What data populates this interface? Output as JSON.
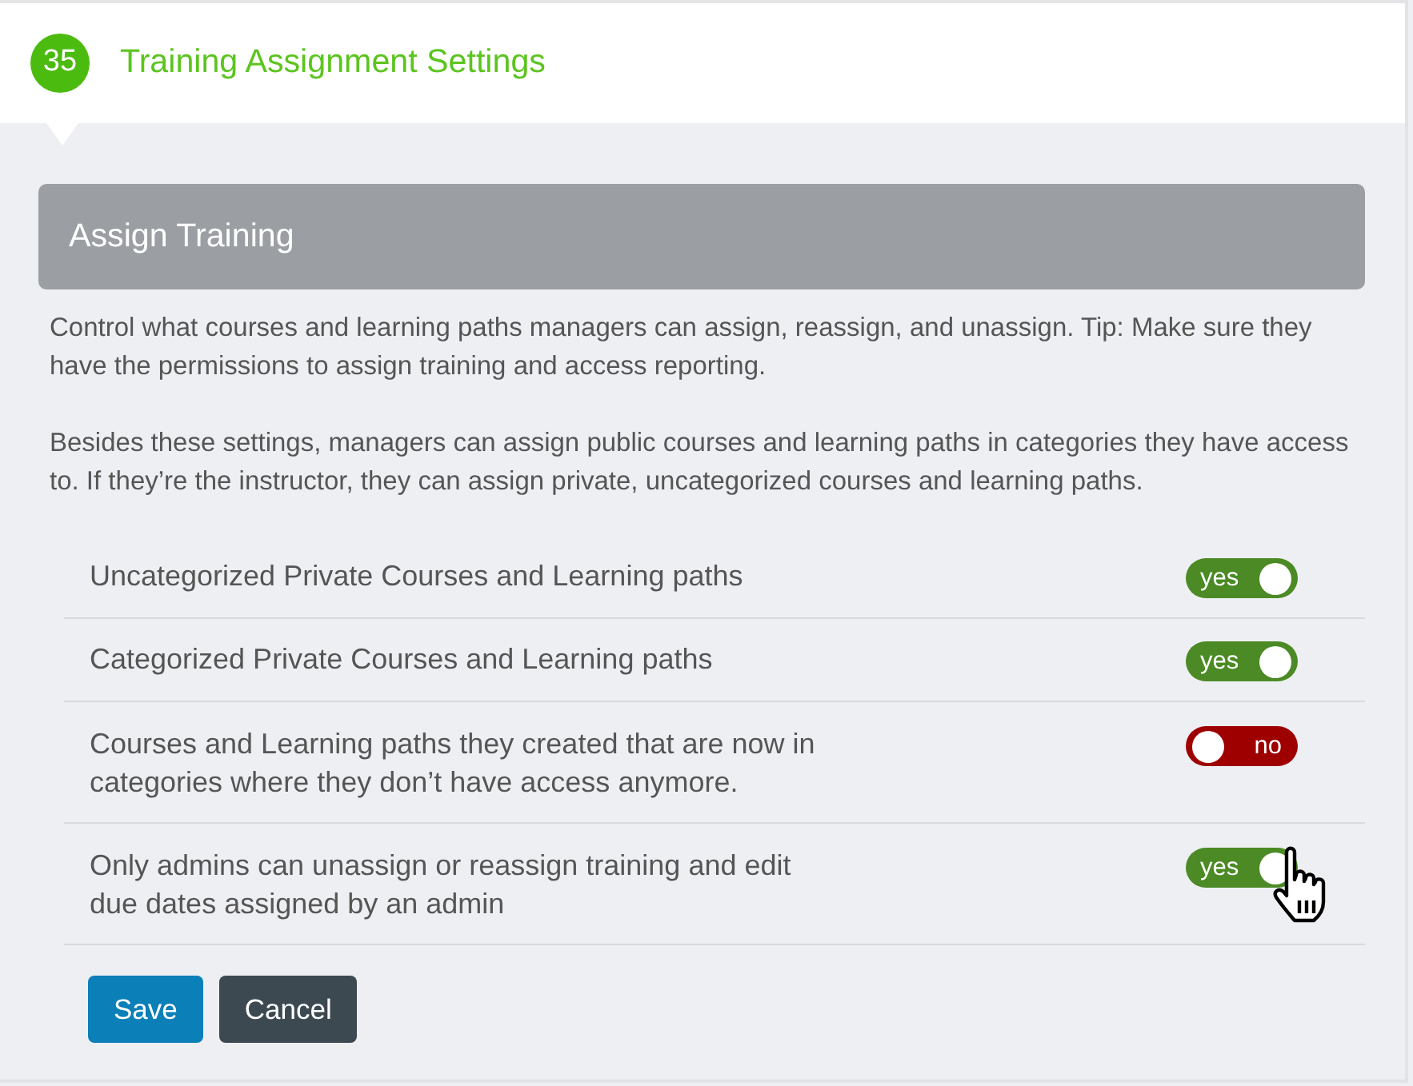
{
  "header": {
    "step": "35",
    "title": "Training Assignment Settings"
  },
  "section": {
    "title": "Assign Training"
  },
  "paragraphs": [
    "Control what courses and learning paths managers can assign, reassign, and unassign. Tip: Make sure they have the permissions to assign training and access reporting.",
    "Besides these settings, managers can assign public courses and learning paths in categories they have access to. If they’re the instructor, they can assign private, uncategorized courses and learning paths."
  ],
  "settings": [
    {
      "label": "Uncategorized Private Courses and Learning paths",
      "on": true,
      "toggle_text": "yes",
      "cursor_over": false
    },
    {
      "label": "Categorized Private Courses and Learning paths",
      "on": true,
      "toggle_text": "yes",
      "cursor_over": false
    },
    {
      "label": "Courses and Learning paths they created that are now in categories where they don’t have access anymore.",
      "on": false,
      "toggle_text": "no",
      "cursor_over": false
    },
    {
      "label": "Only admins can unassign or reassign training and edit due dates assigned by an admin",
      "on": true,
      "toggle_text": "yes",
      "cursor_over": true
    }
  ],
  "buttons": [
    {
      "label": "Save",
      "kind": "primary"
    },
    {
      "label": "Cancel",
      "kind": "secondary"
    }
  ]
}
